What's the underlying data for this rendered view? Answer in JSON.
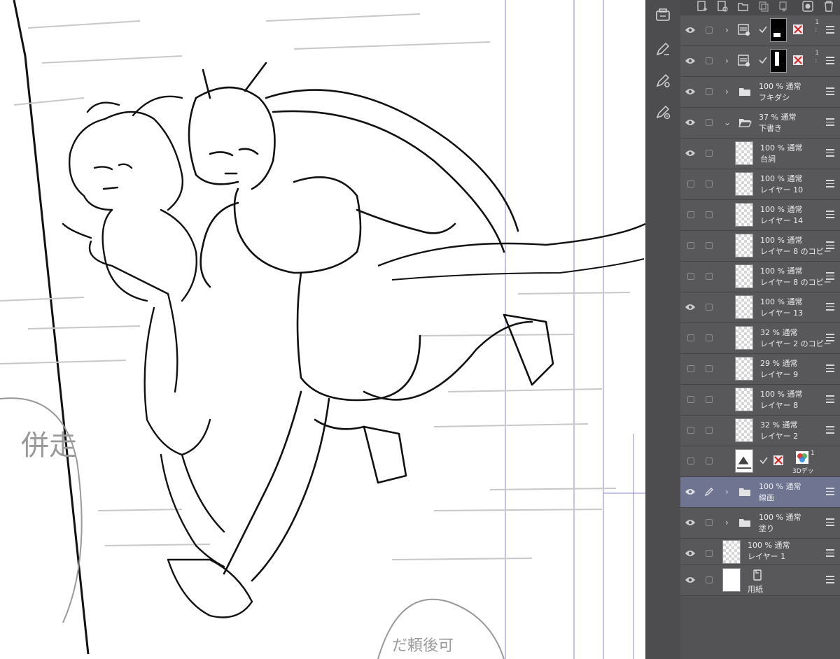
{
  "canvas": {
    "sketch_texts": [
      "併走",
      "だ頼後可"
    ]
  },
  "tool_strip": {
    "icons": [
      "layer-palette-icon",
      "pen-edit-icon",
      "pen-settings-icon",
      "pen-target-icon"
    ]
  },
  "toolbar": {
    "icons": [
      "new-raster-layer-icon",
      "new-vector-layer-icon",
      "new-folder-icon",
      "copy-layer-icon",
      "merge-layer-icon",
      "mask-icon",
      "delete-layer-icon"
    ]
  },
  "layers": [
    {
      "kind": "filter",
      "visible": true,
      "opacity": "",
      "mode": "",
      "name": "",
      "num": "1",
      "num2": ":"
    },
    {
      "kind": "filter",
      "visible": true,
      "opacity": "",
      "mode": "",
      "name": "",
      "num": "1",
      "num2": ":"
    },
    {
      "kind": "folder",
      "visible": true,
      "opacity": "100 %",
      "mode": "通常",
      "name": "フキダシ",
      "expanded": false
    },
    {
      "kind": "folder",
      "visible": true,
      "opacity": "37 %",
      "mode": "通常",
      "name": "下書き",
      "expanded": true
    },
    {
      "kind": "layer",
      "visible": true,
      "indent": true,
      "opacity": "100 %",
      "mode": "通常",
      "name": "台詞"
    },
    {
      "kind": "layer",
      "visible": false,
      "indent": true,
      "opacity": "100 %",
      "mode": "通常",
      "name": "レイヤー 10"
    },
    {
      "kind": "layer",
      "visible": false,
      "indent": true,
      "opacity": "100 %",
      "mode": "通常",
      "name": "レイヤー 14"
    },
    {
      "kind": "layer",
      "visible": false,
      "indent": true,
      "opacity": "100 %",
      "mode": "通常",
      "name": "レイヤー 8 のコピー"
    },
    {
      "kind": "layer",
      "visible": false,
      "indent": true,
      "opacity": "100 %",
      "mode": "通常",
      "name": "レイヤー 8 のコピー"
    },
    {
      "kind": "layer",
      "visible": true,
      "indent": true,
      "opacity": "100 %",
      "mode": "通常",
      "name": "レイヤー 13"
    },
    {
      "kind": "layer",
      "visible": false,
      "indent": true,
      "opacity": "32 %",
      "mode": "通常",
      "name": "レイヤー 2 のコピー"
    },
    {
      "kind": "layer",
      "visible": false,
      "indent": true,
      "opacity": "29 %",
      "mode": "通常",
      "name": "レイヤー 9"
    },
    {
      "kind": "layer",
      "visible": false,
      "indent": true,
      "opacity": "100 %",
      "mode": "通常",
      "name": "レイヤー 8"
    },
    {
      "kind": "layer",
      "visible": false,
      "indent": true,
      "opacity": "32 %",
      "mode": "通常",
      "name": "レイヤー 2"
    },
    {
      "kind": "3d",
      "visible": false,
      "indent": true,
      "opacity": "",
      "mode": "",
      "name": "3Dデッ",
      "num": "1"
    },
    {
      "kind": "folder",
      "visible": true,
      "selected": true,
      "opacity": "100 %",
      "mode": "通常",
      "name": "線画",
      "expanded": false
    },
    {
      "kind": "folder",
      "visible": true,
      "opacity": "100 %",
      "mode": "通常",
      "name": "塗り",
      "expanded": false
    },
    {
      "kind": "layer",
      "visible": true,
      "opacity": "100 %",
      "mode": "通常",
      "name": "レイヤー 1"
    },
    {
      "kind": "paper",
      "visible": true,
      "opacity": "",
      "mode": "",
      "name": "用紙"
    }
  ]
}
